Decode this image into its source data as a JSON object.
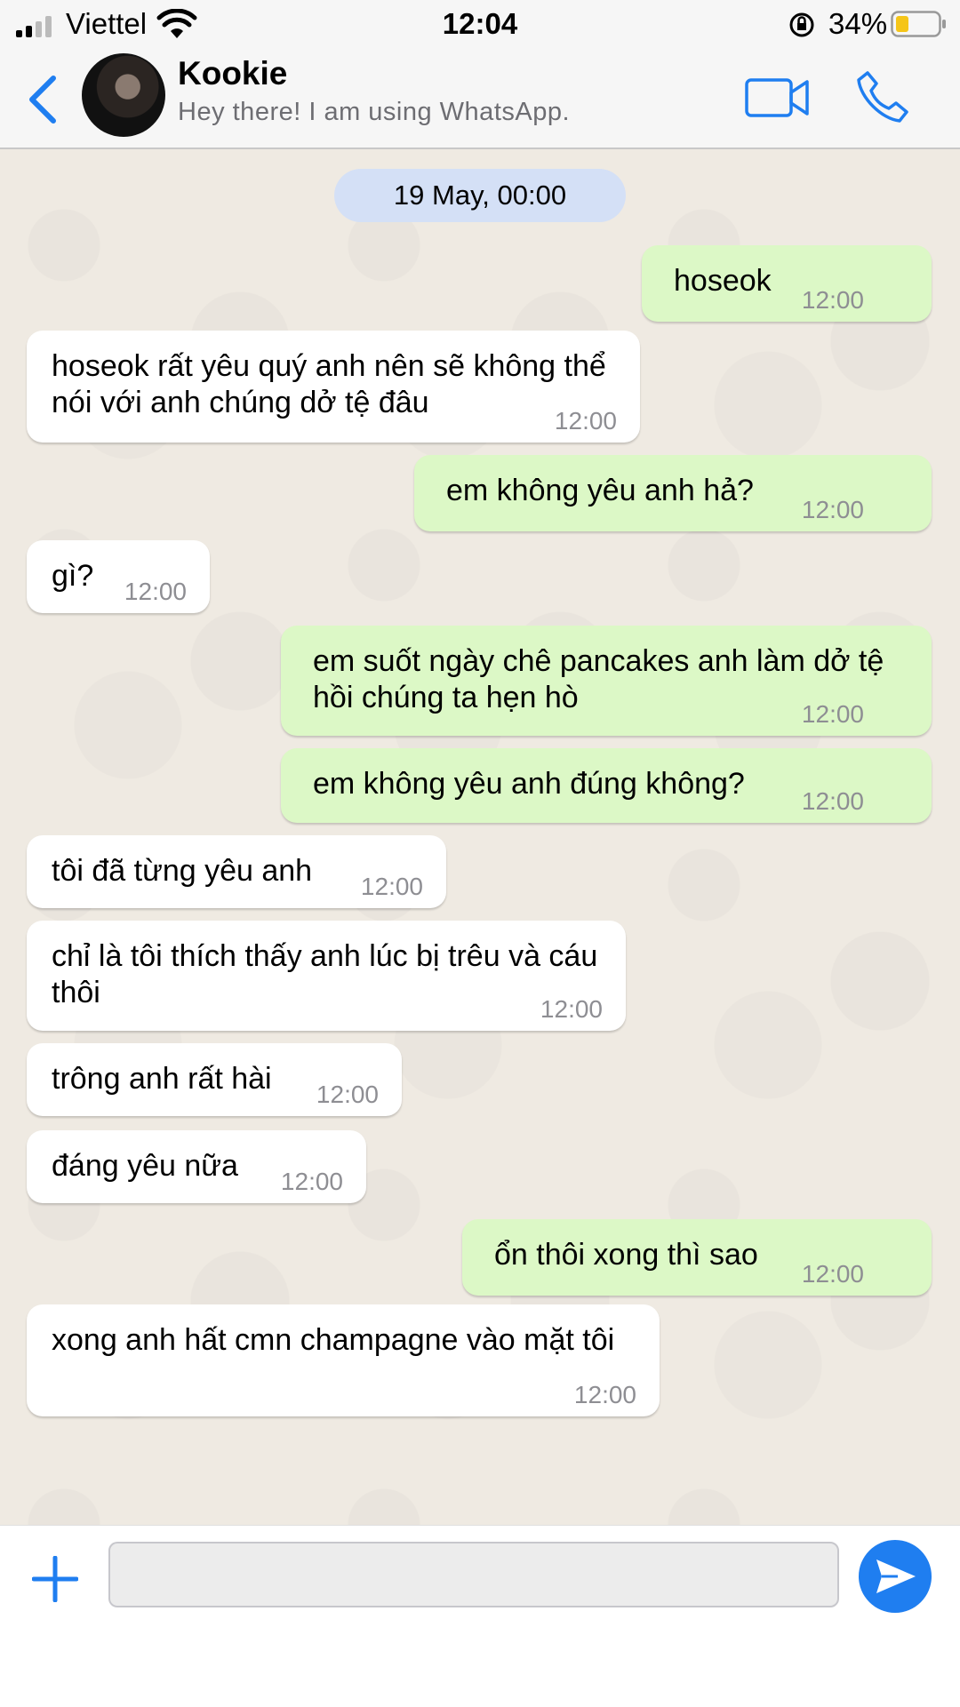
{
  "status_bar": {
    "carrier": "Viettel",
    "time": "12:04",
    "battery_percent": "34%"
  },
  "header": {
    "contact_name": "Kookie",
    "contact_status": "Hey there! I am using WhatsApp."
  },
  "chat": {
    "date_separator": "19 May, 00:00",
    "messages": [
      {
        "direction": "outgoing",
        "text": "hoseok",
        "time": "12:00"
      },
      {
        "direction": "incoming",
        "text": "hoseok rất yêu quý anh nên sẽ không thể nói với anh chúng dở tệ đâu",
        "time": "12:00"
      },
      {
        "direction": "outgoing",
        "text": "em không yêu anh hả?",
        "time": "12:00"
      },
      {
        "direction": "incoming",
        "text": "gì?",
        "time": "12:00"
      },
      {
        "direction": "outgoing",
        "text": "em suốt ngày chê pancakes anh làm dở tệ hồi chúng ta hẹn hò",
        "time": "12:00"
      },
      {
        "direction": "outgoing",
        "text": "em không yêu anh đúng không?",
        "time": "12:00"
      },
      {
        "direction": "incoming",
        "text": "tôi đã từng yêu anh",
        "time": "12:00"
      },
      {
        "direction": "incoming",
        "text": "chỉ là tôi thích thấy anh lúc bị trêu và cáu thôi",
        "time": "12:00"
      },
      {
        "direction": "incoming",
        "text": "trông anh rất hài",
        "time": "12:00"
      },
      {
        "direction": "incoming",
        "text": "đáng yêu nữa",
        "time": "12:00"
      },
      {
        "direction": "outgoing",
        "text": "ổn thôi xong thì sao",
        "time": "12:00"
      },
      {
        "direction": "incoming",
        "text": "xong anh hất cmn champagne vào mặt tôi",
        "time": "12:00"
      }
    ]
  },
  "composer": {
    "input_value": "",
    "plus_icon": "plus-icon",
    "send_icon": "send-icon"
  },
  "colors": {
    "accent": "#1f7ef0",
    "outgoing_bubble": "#dcf8c6",
    "incoming_bubble": "#ffffff",
    "date_pill": "#d4e0f6"
  }
}
